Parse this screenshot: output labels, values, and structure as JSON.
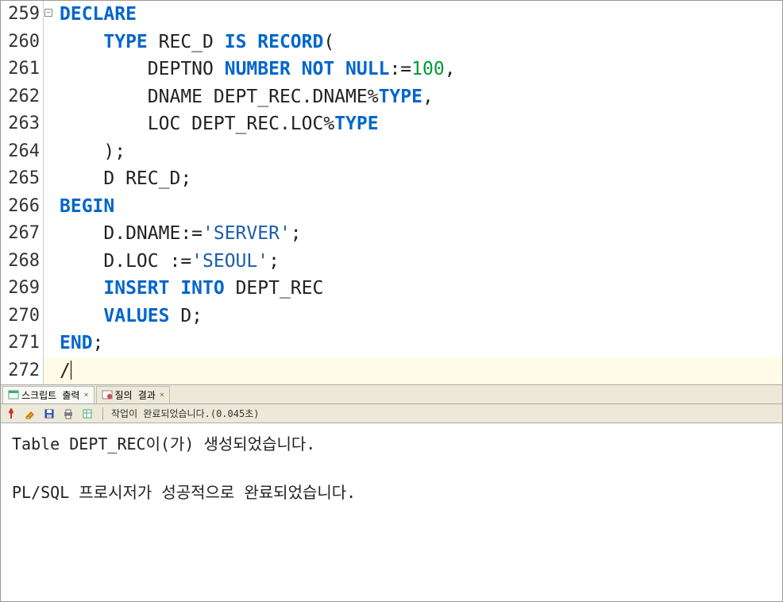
{
  "editor": {
    "lines": [
      {
        "num": "259",
        "fold": true
      },
      {
        "num": "260"
      },
      {
        "num": "261"
      },
      {
        "num": "262"
      },
      {
        "num": "263"
      },
      {
        "num": "264"
      },
      {
        "num": "265"
      },
      {
        "num": "266"
      },
      {
        "num": "267"
      },
      {
        "num": "268"
      },
      {
        "num": "269"
      },
      {
        "num": "270"
      },
      {
        "num": "271"
      },
      {
        "num": "272",
        "current": true
      }
    ],
    "tokens": {
      "l259_declare": "DECLARE",
      "l260_type": "TYPE",
      "l260_recd": " REC_D ",
      "l260_is": "IS",
      "l260_record": " RECORD",
      "l260_paren": "(",
      "l261_deptno": "DEPTNO ",
      "l261_number": "NUMBER NOT NULL",
      "l261_assign": ":=",
      "l261_val": "100",
      "l261_comma": ",",
      "l262_dname": "DNAME DEPT_REC.DNAME%",
      "l262_type": "TYPE",
      "l262_comma": ",",
      "l263_loc": "LOC DEPT_REC.LOC%",
      "l263_type": "TYPE",
      "l264_close": ");",
      "l265_d": "D REC_D;",
      "l266_begin": "BEGIN",
      "l267_a": "D.DNAME:=",
      "l267_str": "'SERVER'",
      "l267_semi": ";",
      "l268_a": "D.LOC :=",
      "l268_str": "'SEOUL'",
      "l268_semi": ";",
      "l269_insert": "INSERT INTO",
      "l269_tbl": " DEPT_REC",
      "l270_values": "VALUES",
      "l270_d": " D;",
      "l271_end": "END",
      "l271_semi": ";",
      "l272_slash": "/"
    }
  },
  "tabs": {
    "script_output": "스크립트 출력",
    "query_result": "질의 결과"
  },
  "toolbar": {
    "status": "작업이 완료되었습니다.(0.045초)"
  },
  "output": {
    "line1": "Table DEPT_REC이(가) 생성되었습니다.",
    "line2": "PL/SQL 프로시저가 성공적으로 완료되었습니다."
  }
}
